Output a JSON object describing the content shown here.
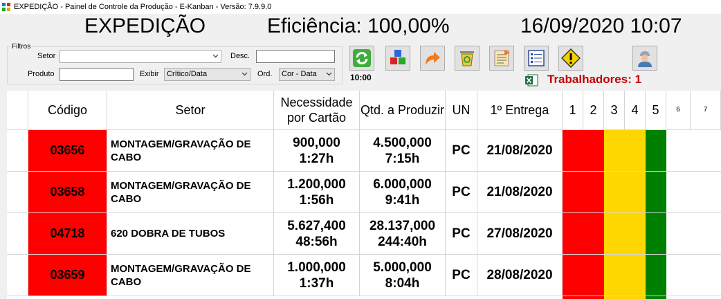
{
  "window": {
    "title": "EXPEDIÇÃO - Painel de Controle da Produção - E-Kanban - Versão: 7.9.9.0"
  },
  "header": {
    "sector": "EXPEDIÇÃO",
    "efficiency": "Eficiência: 100,00%",
    "datetime": "16/09/2020 10:07"
  },
  "filters": {
    "legend": "Filtros",
    "setor_label": "Setor",
    "setor_value": "",
    "desc_label": "Desc.",
    "desc_value": "",
    "produto_label": "Produto",
    "produto_value": "",
    "exibir_label": "Exibir",
    "exibir_value": "Crítico/Data",
    "ord_label": "Ord.",
    "ord_value": "Cor - Data"
  },
  "toolbar": {
    "refresh_time": "10:00",
    "buttons": [
      "refresh-icon",
      "cubes-icon",
      "arrow-icon",
      "recycle-bin-icon",
      "document-icon",
      "checklist-icon",
      "warning-icon",
      "worker-icon"
    ],
    "workers": "Trabalhadores: 1"
  },
  "table": {
    "headers": {
      "codigo": "Código",
      "setor": "Setor",
      "necessidade": "Necessidade por Cartão",
      "qtd": "Qtd. a Produzir",
      "un": "UN",
      "entrega": "1º Entrega",
      "c1": "1",
      "c2": "2",
      "c3": "3",
      "c4": "4",
      "c5": "5",
      "c6": "6",
      "c7": "7"
    },
    "band_colors": [
      "#ff0000",
      "#ff0000",
      "#ffd700",
      "#ffd700",
      "#008000"
    ],
    "rows": [
      {
        "codigo": "03656",
        "setor": "MONTAGEM/GRAVAÇÃO DE CABO",
        "necessidade": "900,000",
        "necessidade_tempo": "1:27h",
        "qtd": "4.500,000",
        "qtd_tempo": "7:15h",
        "un": "PC",
        "entrega": "21/08/2020"
      },
      {
        "codigo": "03658",
        "setor": "MONTAGEM/GRAVAÇÃO DE CABO",
        "necessidade": "1.200,000",
        "necessidade_tempo": "1:56h",
        "qtd": "6.000,000",
        "qtd_tempo": "9:41h",
        "un": "PC",
        "entrega": "21/08/2020"
      },
      {
        "codigo": "04718",
        "setor": "620 DOBRA DE TUBOS",
        "necessidade": "5.627,400",
        "necessidade_tempo": "48:56h",
        "qtd": "28.137,000",
        "qtd_tempo": "244:40h",
        "un": "PC",
        "entrega": "27/08/2020"
      },
      {
        "codigo": "03659",
        "setor": "MONTAGEM/GRAVAÇÃO DE CABO",
        "necessidade": "1.000,000",
        "necessidade_tempo": "1:37h",
        "qtd": "5.000,000",
        "qtd_tempo": "8:04h",
        "un": "PC",
        "entrega": "28/08/2020"
      }
    ]
  }
}
